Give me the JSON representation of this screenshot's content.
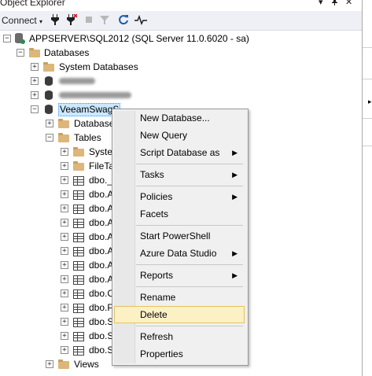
{
  "window": {
    "title": "Object Explorer",
    "controls": [
      "▾",
      "📌",
      "✕"
    ]
  },
  "toolbar": {
    "connect_label": "Connect",
    "connect_arrow": "▾"
  },
  "tree": {
    "server": {
      "label": "APPSERVER\\SQL2012 (SQL Server 11.0.6020 - sa)",
      "expander": "⊟"
    },
    "databases": {
      "label": "Databases"
    },
    "system_databases": {
      "label": "System Databases"
    },
    "db_selected": {
      "label": "VeeamSwagS"
    },
    "db_children": [
      {
        "label": "Database"
      },
      {
        "label": "Tables"
      }
    ],
    "tables_children": [
      {
        "label": "Syster",
        "icon": "folder"
      },
      {
        "label": "FileTa",
        "icon": "folder"
      },
      {
        "label": "dbo._",
        "icon": "table"
      },
      {
        "label": "dbo.A",
        "icon": "table"
      },
      {
        "label": "dbo.A",
        "icon": "table"
      },
      {
        "label": "dbo.A",
        "icon": "table"
      },
      {
        "label": "dbo.A",
        "icon": "table"
      },
      {
        "label": "dbo.A",
        "icon": "table"
      },
      {
        "label": "dbo.A",
        "icon": "table"
      },
      {
        "label": "dbo.A",
        "icon": "table"
      },
      {
        "label": "dbo.C",
        "icon": "table"
      },
      {
        "label": "dbo.P",
        "icon": "table"
      },
      {
        "label": "dbo.S",
        "icon": "table"
      },
      {
        "label": "dbo.S",
        "icon": "table"
      },
      {
        "label": "dbo.S",
        "icon": "table"
      }
    ],
    "views": {
      "label": "Views"
    }
  },
  "context_menu": {
    "items": [
      {
        "label": "New Database...",
        "submenu": false
      },
      {
        "label": "New Query",
        "submenu": false
      },
      {
        "label": "Script Database as",
        "submenu": true
      },
      {
        "label": "Tasks",
        "submenu": true
      },
      {
        "label": "Policies",
        "submenu": true
      },
      {
        "label": "Facets",
        "submenu": false
      },
      {
        "label": "Start PowerShell",
        "submenu": false
      },
      {
        "label": "Azure Data Studio",
        "submenu": true
      },
      {
        "label": "Reports",
        "submenu": true
      },
      {
        "label": "Rename",
        "submenu": false
      },
      {
        "label": "Delete",
        "submenu": false,
        "highlighted": true
      },
      {
        "label": "Refresh",
        "submenu": false
      },
      {
        "label": "Properties",
        "submenu": false
      }
    ],
    "submenu_arrow": "▶"
  },
  "colors": {
    "highlight_bg": "#fcf1c4",
    "highlight_border": "#e5c365",
    "folder": "#dcb67a",
    "selection": "#cce8ff"
  }
}
